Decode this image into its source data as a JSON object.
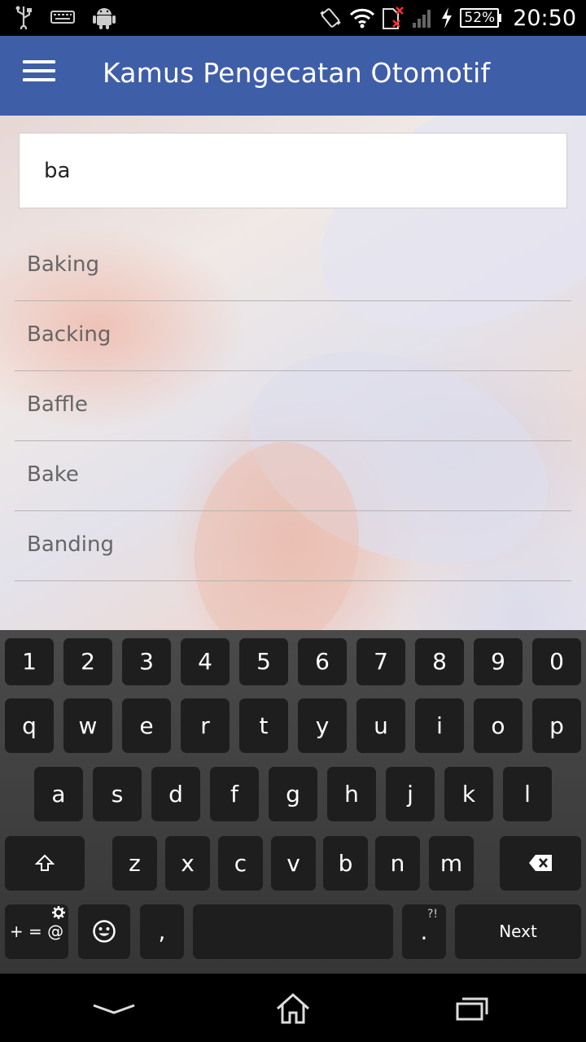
{
  "statusbar": {
    "battery": "52%",
    "time": "20:50",
    "icons": [
      "usb-icon",
      "keyboard-icon",
      "android-icon",
      "vibrate-icon",
      "wifi-icon",
      "sim-icon",
      "signal-icon",
      "charging-icon"
    ]
  },
  "appbar": {
    "title": "Kamus Pengecatan Otomotif",
    "menu_icon": "hamburger-menu-icon"
  },
  "search": {
    "value": "ba"
  },
  "results": [
    "Baking",
    "Backing",
    "Baffle",
    "Bake",
    "Banding"
  ],
  "keyboard": {
    "row1": [
      "1",
      "2",
      "3",
      "4",
      "5",
      "6",
      "7",
      "8",
      "9",
      "0"
    ],
    "row2": [
      "q",
      "w",
      "e",
      "r",
      "t",
      "y",
      "u",
      "i",
      "o",
      "p"
    ],
    "row3": [
      "a",
      "s",
      "d",
      "f",
      "g",
      "h",
      "j",
      "k",
      "l"
    ],
    "row4": [
      "z",
      "x",
      "c",
      "v",
      "b",
      "n",
      "m"
    ],
    "symbols_label": "+ = @",
    "comma": ",",
    "period": ".",
    "period_sup": "?!",
    "next_label": "Next"
  },
  "colors": {
    "appbar": "#3f5ea8",
    "keyboard_key": "#1e1e1e"
  }
}
